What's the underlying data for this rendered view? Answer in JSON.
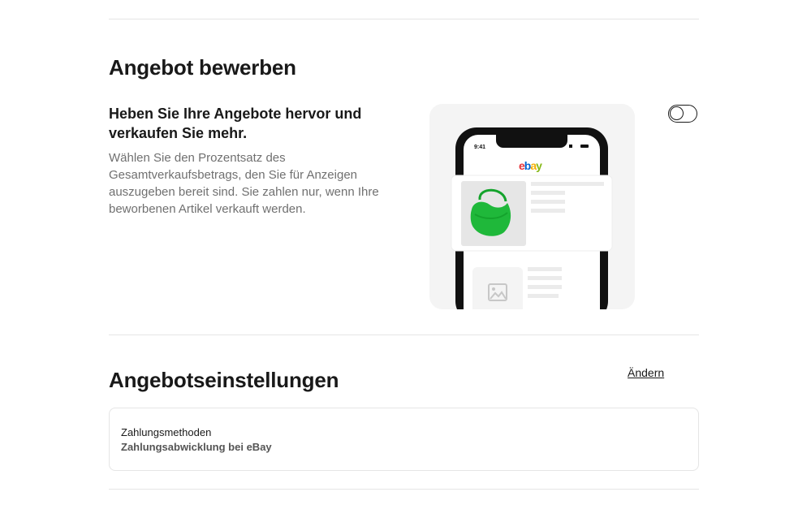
{
  "promote": {
    "title": "Angebot bewerben",
    "headline": "Heben Sie Ihre Angebote hervor und verkaufen Sie mehr.",
    "description": "Wählen Sie den Prozentsatz des Gesamtverkaufsbetrags, den Sie für Anzeigen auszugeben bereit sind. Sie zahlen nur, wenn Ihre beworbenen Artikel verkauft werden.",
    "toggle_on": false,
    "illustration": {
      "phone_time": "9:41",
      "brand": "ebay",
      "brand_colors": [
        "#e53238",
        "#0064d2",
        "#f5af02",
        "#86b817"
      ],
      "product_color": "#1fb83a"
    }
  },
  "listing_settings": {
    "title": "Angebotseinstellungen",
    "change_label": "Ändern",
    "payment": {
      "label": "Zahlungsmethoden",
      "value": "Zahlungsabwicklung bei eBay"
    }
  }
}
